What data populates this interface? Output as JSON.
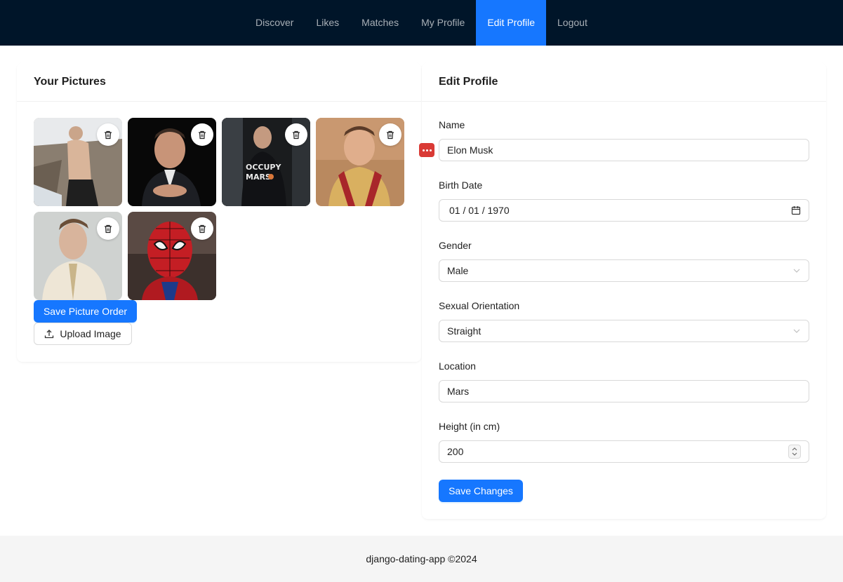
{
  "nav": {
    "items": [
      {
        "label": "Discover",
        "active": false
      },
      {
        "label": "Likes",
        "active": false
      },
      {
        "label": "Matches",
        "active": false
      },
      {
        "label": "My Profile",
        "active": false
      },
      {
        "label": "Edit Profile",
        "active": true
      },
      {
        "label": "Logout",
        "active": false
      }
    ]
  },
  "pictures": {
    "title": "Your Pictures",
    "save_order_label": "Save Picture Order",
    "upload_label": "Upload Image",
    "items": [
      {
        "alt": "photo-1",
        "icon": "trash-icon"
      },
      {
        "alt": "photo-2",
        "icon": "trash-icon"
      },
      {
        "alt": "photo-3",
        "icon": "trash-icon"
      },
      {
        "alt": "photo-4",
        "icon": "trash-icon"
      },
      {
        "alt": "photo-5",
        "icon": "trash-icon"
      },
      {
        "alt": "photo-6",
        "icon": "trash-icon"
      }
    ]
  },
  "profile": {
    "title": "Edit Profile",
    "name_label": "Name",
    "name_value": "Elon Musk",
    "birth_label": "Birth Date",
    "birth_value": "01 / 01 / 1970",
    "gender_label": "Gender",
    "gender_value": "Male",
    "orientation_label": "Sexual Orientation",
    "orientation_value": "Straight",
    "location_label": "Location",
    "location_value": "Mars",
    "height_label": "Height (in cm)",
    "height_value": "200",
    "save_label": "Save Changes"
  },
  "footer": {
    "text": "django-dating-app ©2024"
  },
  "colors": {
    "header_bg": "#001529",
    "primary": "#1677ff",
    "footer_bg": "#f5f5f5",
    "password_badge": "#d93a35"
  }
}
